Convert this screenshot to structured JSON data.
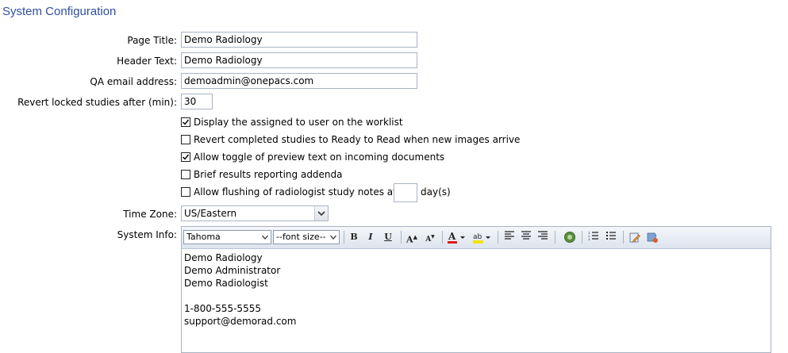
{
  "page": {
    "title": "System Configuration"
  },
  "form": {
    "page_title": {
      "label": "Page Title:",
      "value": "Demo Radiology"
    },
    "header_text": {
      "label": "Header Text:",
      "value": "Demo Radiology"
    },
    "qa_email": {
      "label": "QA email address:",
      "value": "demoadmin@onepacs.com"
    },
    "revert_locked": {
      "label": "Revert locked studies after (min):",
      "value": "30"
    },
    "checkboxes": [
      {
        "label": "Display the assigned to user on the worklist",
        "checked": true
      },
      {
        "label": "Revert completed studies to Ready to Read when new images arrive",
        "checked": false
      },
      {
        "label": "Allow toggle of preview text on incoming documents",
        "checked": true
      },
      {
        "label": "Brief results reporting addenda",
        "checked": false
      },
      {
        "label": "Allow flushing of radiologist study notes after",
        "checked": false
      }
    ],
    "flush_days": {
      "value": "",
      "unit": "day(s)"
    },
    "time_zone": {
      "label": "Time Zone:",
      "value": "US/Eastern"
    },
    "system_info": {
      "label": "System Info:",
      "font_family": "Tahoma",
      "font_size_placeholder": "--font size--",
      "toolbar_icons": [
        "bold-icon",
        "italic-icon",
        "underline-icon",
        "font-size-increase-icon",
        "font-size-decrease-icon",
        "font-color-icon",
        "highlight-color-icon",
        "align-left-icon",
        "align-center-icon",
        "align-right-icon",
        "insert-link-icon",
        "numbered-list-icon",
        "bulleted-list-icon",
        "edit-source-icon",
        "clear-formatting-icon"
      ],
      "content": "Demo Radiology\nDemo Administrator\nDemo Radiologist\n\n1-800-555-5555\nsupport@demorad.com"
    }
  },
  "colors": {
    "title": "#2f4f9b",
    "input_border": "#aab4c4",
    "toolbar_bg": "#dde4ee",
    "font_color_bar": "#e01a1a",
    "highlight_bar": "#f2e200"
  }
}
